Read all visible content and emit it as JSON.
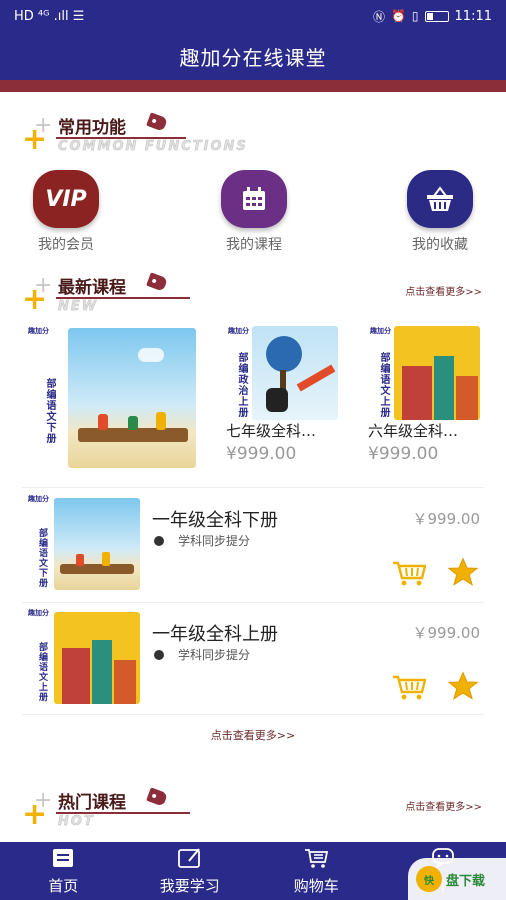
{
  "status_bar": {
    "left": "HD ⁴ᴳ .ıll ☰",
    "time": "11:11"
  },
  "header": {
    "title": "趣加分在线课堂"
  },
  "functions_section": {
    "title": "常用功能",
    "subtitle": "COMMON FUNCTIONS",
    "items": [
      {
        "label": "我的会员",
        "icon": "vip-icon",
        "icon_text": "VIP",
        "color": "#8b2323"
      },
      {
        "label": "我的课程",
        "icon": "calendar-icon",
        "color": "#6b2f86"
      },
      {
        "label": "我的收藏",
        "icon": "basket-icon",
        "color": "#2b2b85"
      }
    ]
  },
  "newest_section": {
    "title": "最新课程",
    "subtitle": "NEW",
    "more": "点击查看更多>>",
    "cards": [
      {
        "badge": "趣加分",
        "vertical": "部编语文下册"
      },
      {
        "badge": "趣加分",
        "vertical": "部编政治上册",
        "name": "七年级全科…",
        "price": "¥999.00"
      },
      {
        "badge": "趣加分",
        "vertical": "部编语文上册",
        "name": "六年级全科…",
        "price": "¥999.00"
      }
    ]
  },
  "course_list": [
    {
      "badge": "趣加分",
      "vertical": "部编语文下册",
      "title": "一年级全科下册",
      "subtitle": "学科同步提分",
      "price": "￥999.00"
    },
    {
      "badge": "趣加分",
      "vertical": "部编语文上册",
      "title": "一年级全科上册",
      "subtitle": "学科同步提分",
      "price": "￥999.00"
    }
  ],
  "list_more": "点击查看更多>>",
  "hot_section": {
    "title": "热门课程",
    "subtitle": "HOT",
    "more": "点击查看更多>>"
  },
  "tabbar": [
    {
      "label": "首页",
      "icon": "home-icon"
    },
    {
      "label": "我要学习",
      "icon": "study-icon"
    },
    {
      "label": "购物车",
      "icon": "cart-icon"
    },
    {
      "label": "个",
      "icon": "chat-icon"
    }
  ],
  "watermark": {
    "logo": "快",
    "text": "盘下载"
  },
  "colors": {
    "primary": "#2a2a8a",
    "accent": "#8b2e3a",
    "yellow": "#f0b100"
  }
}
